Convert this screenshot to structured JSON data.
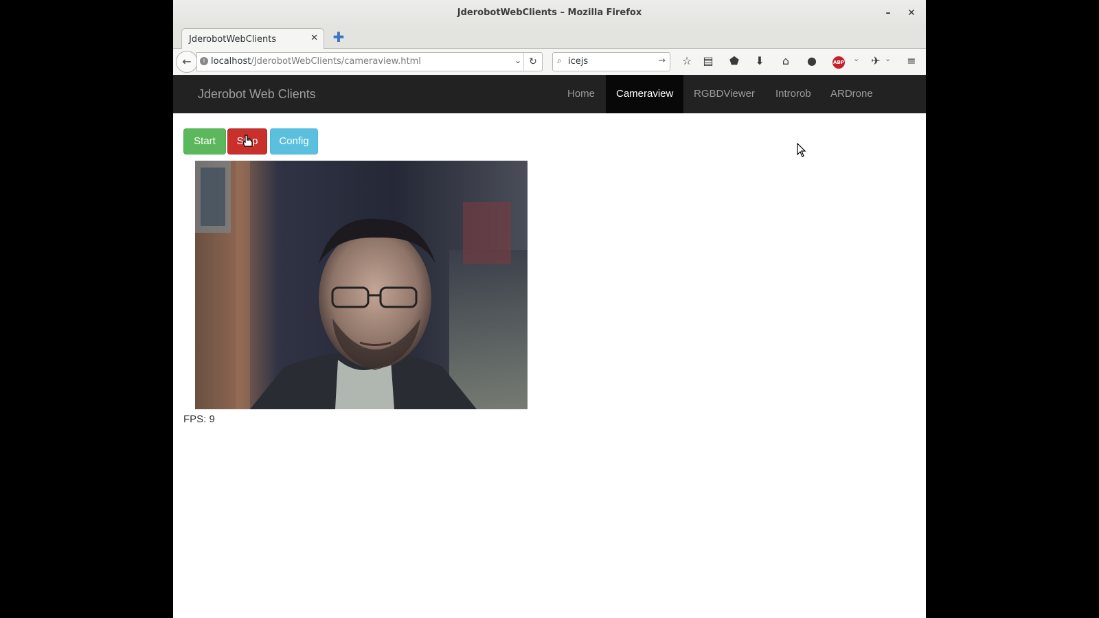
{
  "window": {
    "title": "JderobotWebClients – Mozilla Firefox",
    "minimize_glyph": "–",
    "close_glyph": "✕"
  },
  "browser": {
    "tab_label": "JderobotWebClients",
    "tab_close_glyph": "✕",
    "new_tab_glyph": "✚",
    "url_host": "localhost",
    "url_path": "/JderobotWebClients/cameraview.html",
    "search_value": "icejs",
    "toolbar_icons": [
      "bookmark-star-icon",
      "reading-list-icon",
      "pocket-icon",
      "download-icon",
      "home-icon",
      "chat-icon",
      "adblock-plus-icon",
      "extension-icon",
      "menu-icon"
    ],
    "abp_label": "ABP"
  },
  "app": {
    "brand": "Jderobot Web Clients",
    "nav": [
      {
        "label": "Home",
        "active": false
      },
      {
        "label": "Cameraview",
        "active": true
      },
      {
        "label": "RGBDViewer",
        "active": false
      },
      {
        "label": "Introrob",
        "active": false
      },
      {
        "label": "ARDrone",
        "active": false
      }
    ],
    "buttons": {
      "start": "Start",
      "stop": "Stop",
      "config": "Config"
    },
    "fps_label": "FPS:",
    "fps_value": "9"
  },
  "colors": {
    "start": "#5cb85c",
    "stop": "#c9302c",
    "config": "#5bc0de",
    "navbar": "#222222",
    "nav_active": "#080808"
  }
}
